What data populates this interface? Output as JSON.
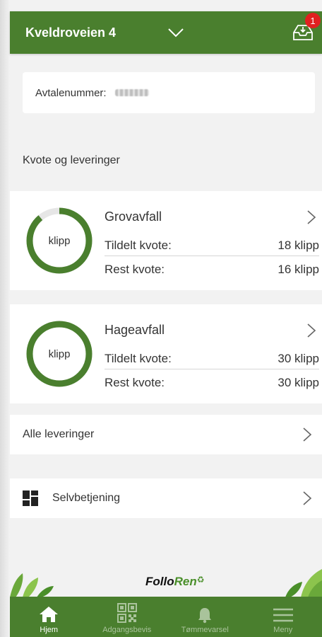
{
  "header": {
    "title": "Kveldroveien 4",
    "notification_count": "1"
  },
  "agreement": {
    "label": "Avtalenummer:"
  },
  "section": {
    "title": "Kvote og leveringer"
  },
  "quotas": [
    {
      "name": "Grovavfall",
      "ring_label": "klipp",
      "assigned_label": "Tildelt kvote:",
      "assigned_value": "18 klipp",
      "rest_label": "Rest kvote:",
      "rest_value": "16 klipp",
      "remaining_fraction": 0.889
    },
    {
      "name": "Hageavfall",
      "ring_label": "klipp",
      "assigned_label": "Tildelt kvote:",
      "assigned_value": "30 klipp",
      "rest_label": "Rest kvote:",
      "rest_value": "30 klipp",
      "remaining_fraction": 1.0
    }
  ],
  "links": {
    "all_deliveries": "Alle leveringer",
    "self_service": "Selvbetjening"
  },
  "footer": {
    "logo_part1": "Follo",
    "logo_part2": "Ren"
  },
  "tabs": [
    {
      "label": "Hjem",
      "icon": "home-icon",
      "active": true
    },
    {
      "label": "Adgangsbevis",
      "icon": "qr-code-icon",
      "active": false
    },
    {
      "label": "Tømmevarsel",
      "icon": "bell-icon",
      "active": false
    },
    {
      "label": "Meny",
      "icon": "menu-icon",
      "active": false
    }
  ],
  "colors": {
    "brand_green": "#4a7f2e",
    "ring_track": "#e6e6e6",
    "badge_red": "#e02020"
  }
}
